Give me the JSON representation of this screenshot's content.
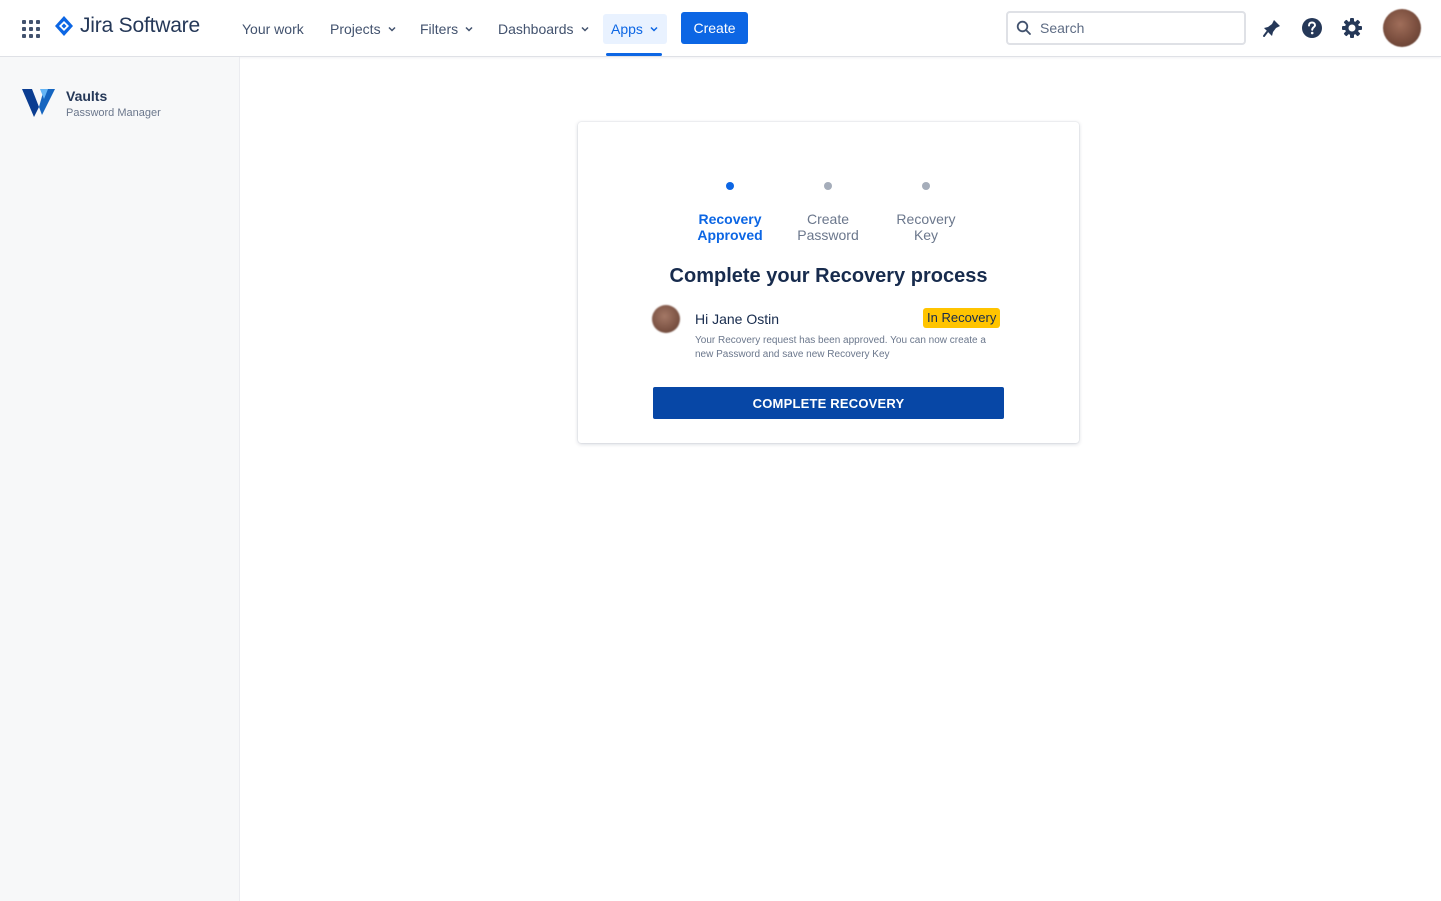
{
  "topnav": {
    "brand_name": "Jira Software",
    "items": [
      {
        "label": "Your work",
        "has_dropdown": false
      },
      {
        "label": "Projects",
        "has_dropdown": true
      },
      {
        "label": "Filters",
        "has_dropdown": true
      },
      {
        "label": "Dashboards",
        "has_dropdown": true
      },
      {
        "label": "Apps",
        "has_dropdown": true,
        "active": true
      }
    ],
    "create_label": "Create",
    "search_placeholder": "Search",
    "icons": [
      "app-switcher-icon",
      "jira-logo-icon",
      "search-icon",
      "notifications-icon",
      "help-icon",
      "settings-icon"
    ]
  },
  "sidebar": {
    "title": "Vaults",
    "subtitle": "Password Manager"
  },
  "recovery": {
    "steps": [
      {
        "label": "Recovery\nApproved",
        "active": true
      },
      {
        "label": "Create\nPassword",
        "active": false
      },
      {
        "label": "Recovery\nKey",
        "active": false
      }
    ],
    "title": "Complete your Recovery process",
    "greeting": "Hi Jane Ostin",
    "badge": "In Recovery",
    "message": "Your Recovery request has been approved. You can now create a new Password and save new Recovery Key",
    "button_label": "COMPLETE RECOVERY"
  },
  "colors": {
    "primary": "#0c66e4",
    "button_dark": "#0747a6",
    "badge": "#ffc400",
    "sidebar_bg": "#f7f8f9"
  }
}
